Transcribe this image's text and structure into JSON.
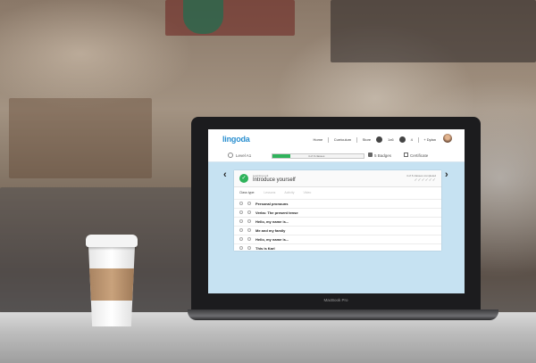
{
  "logo": "lingoda",
  "nav": {
    "items": [
      "Home",
      "Curriculum",
      "Store"
    ],
    "credit_count": "1x6",
    "notification_count": "4",
    "user_name": "+ Dylan"
  },
  "level_bar": {
    "level_label": "Level A1",
    "progress_text": "4 of 9 classes",
    "progress_fraction": 0.2,
    "badges_label": "5 Badges",
    "certificate_label": "Certificate"
  },
  "card": {
    "unit_label": "Learning unit",
    "unit_title": "Introduce yourself",
    "classes_completed": "4 of 6 classes completed",
    "checks": "✓✓✓✓✓✓",
    "filter_label": "Class type:",
    "filter_options": [
      "Lessons",
      "Activity",
      "Video"
    ],
    "lessons": [
      "Personal pronouns",
      "Verbs: The present tense",
      "Hello, my name is...",
      "Me and my family",
      "Hello, my name is...",
      "This is Karl"
    ]
  },
  "laptop": {
    "model": "MacBook Pro"
  },
  "colors": {
    "accent": "#2fb35b",
    "brand": "#2a8fd0",
    "screen_bg": "#c6e2f2"
  }
}
